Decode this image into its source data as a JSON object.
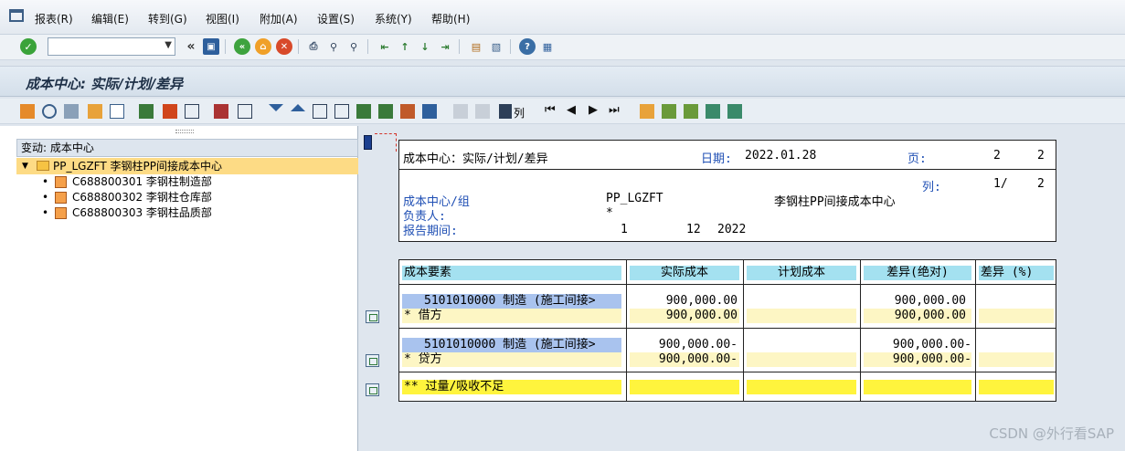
{
  "menubar": {
    "items": [
      "报表(R)",
      "编辑(E)",
      "转到(G)",
      "视图(I)",
      "附加(A)",
      "设置(S)",
      "系统(Y)",
      "帮助(H)"
    ]
  },
  "toolbar": {
    "command_value": "",
    "back_glyph": "«"
  },
  "title": "成本中心: 实际/计划/差异",
  "appbar": {
    "column_button_label": "列"
  },
  "tree": {
    "header": "变动: 成本中心",
    "root": "PP_LGZFT 李钢柱PP间接成本中心",
    "children": [
      "C688800301 李钢柱制造部",
      "C688800302 李钢柱仓库部",
      "C688800303 李钢柱品质部"
    ]
  },
  "report": {
    "header": {
      "title": "成本中心：实际/计划/差异",
      "date_label": "日期:",
      "date_value": "2022.01.28",
      "page_label": "页:",
      "page_current": "2",
      "page_total": "2",
      "col_label": "列:",
      "col_current": "1/",
      "col_total": "2",
      "cc_label": "成本中心/组",
      "cc_code": "PP_LGZFT",
      "cc_name": "李钢柱PP间接成本中心",
      "resp_label": "负责人:",
      "resp_value": "*",
      "period_label": "报告期间:",
      "period_from": "1",
      "period_to": "12",
      "period_year": "2022"
    },
    "table": {
      "headers": [
        "成本要素",
        "实际成本",
        "计划成本",
        "差异(绝对)",
        "差异 (%)"
      ],
      "rows": [
        {
          "element": "5101010000  制造 (施工间接>",
          "actual": "900,000.00",
          "plan": "",
          "var_abs": "900,000.00",
          "var_pct": ""
        },
        {
          "element": "*  借方",
          "actual": "900,000.00",
          "plan": "",
          "var_abs": "900,000.00",
          "var_pct": ""
        },
        {
          "element": "5101010000  制造 (施工间接>",
          "actual": "900,000.00-",
          "plan": "",
          "var_abs": "900,000.00-",
          "var_pct": ""
        },
        {
          "element": "*  贷方",
          "actual": "900,000.00-",
          "plan": "",
          "var_abs": "900,000.00-",
          "var_pct": ""
        },
        {
          "element": "** 过量/吸收不足",
          "actual": "",
          "plan": "",
          "var_abs": "",
          "var_pct": ""
        }
      ]
    }
  },
  "watermark": "CSDN @外行看SAP",
  "colors": {
    "header_cell": "#a4e1f0",
    "element_cell": "#a9c3ee",
    "subtotal_cell": "#fdf6c4",
    "total_cell": "#fff43d",
    "tree_selected": "#fddb85"
  }
}
